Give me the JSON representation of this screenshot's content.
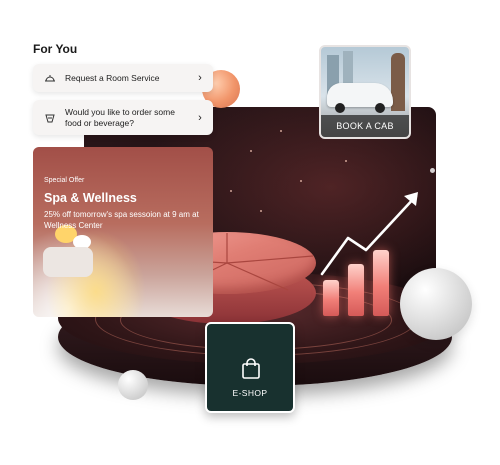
{
  "section": {
    "title": "For You"
  },
  "cards": [
    {
      "icon": "room-service-bell-icon",
      "label": "Request a Room Service"
    },
    {
      "icon": "food-dish-icon",
      "label": "Would you like to order some food or beverage?"
    }
  ],
  "spa": {
    "eyebrow": "Special Offer",
    "title": "Spa & Wellness",
    "description": "25% off tomorrow's spa sessoion at 9 am at Wellness Center"
  },
  "cab": {
    "label": "BOOK A CAB"
  },
  "eshop": {
    "icon": "shopping-bag-icon",
    "label": "E-SHOP"
  },
  "colors": {
    "hero_dark": "#1c0f12",
    "accent_coral": "#f07a6e",
    "eshop_green": "#18312f",
    "orange_ball": "#f1956a"
  }
}
